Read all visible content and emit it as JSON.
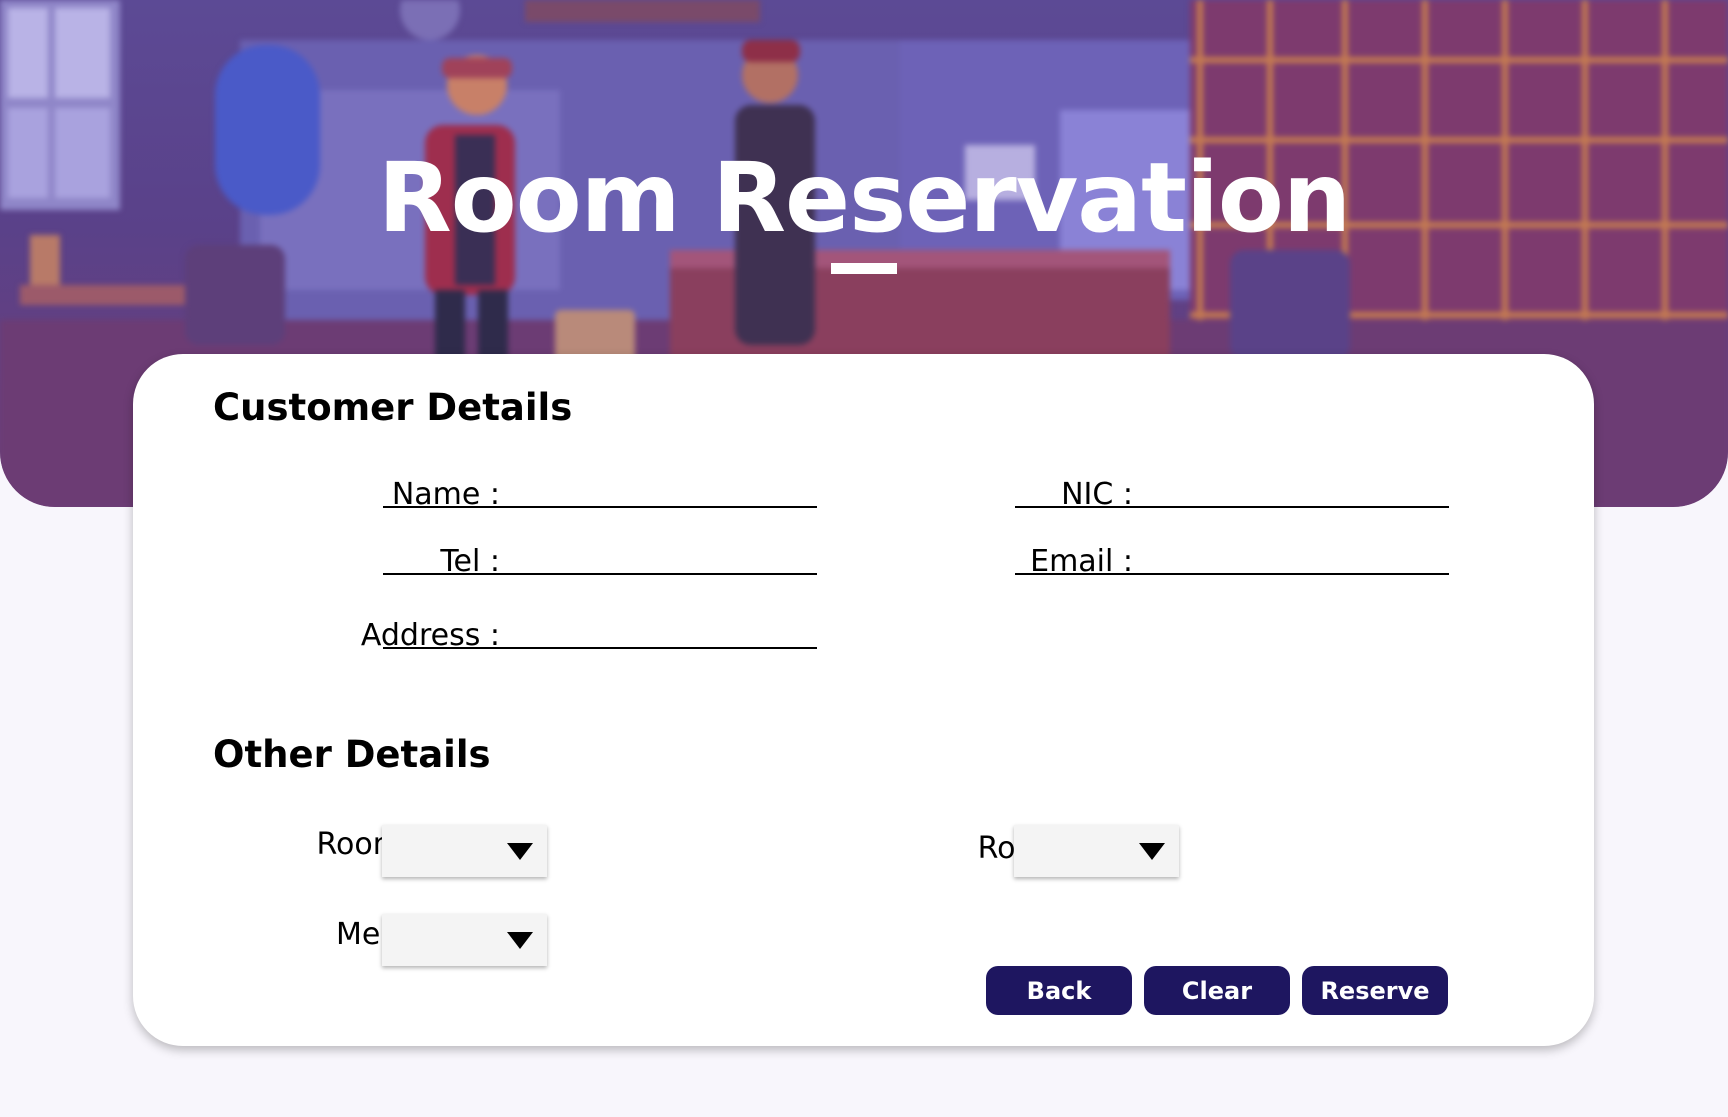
{
  "page": {
    "title": "Room Reservation"
  },
  "customer_details": {
    "heading": "Customer Details",
    "name_label": "Name :",
    "name_value": "",
    "nic_label": "NIC :",
    "nic_value": "",
    "tel_label": "Tel :",
    "tel_value": "",
    "email_label": "Email :",
    "email_value": "",
    "address_label": "Address :",
    "address_value": ""
  },
  "other_details": {
    "heading": "Other Details",
    "room_type_label": "Room Type :",
    "room_type_value": "",
    "room_no_label": "Room No :",
    "room_no_value": "",
    "meal_plan_label": "Meal Plan :",
    "meal_plan_value": ""
  },
  "buttons": {
    "back": "Back",
    "clear": "Clear",
    "reserve": "Reserve"
  },
  "colors": {
    "accent": "#1e1660",
    "hero_purple": "#5a4189",
    "page_background": "#f8f6fc",
    "card_background": "#ffffff"
  },
  "icons": {
    "dropdown": "triangle-down-icon"
  }
}
